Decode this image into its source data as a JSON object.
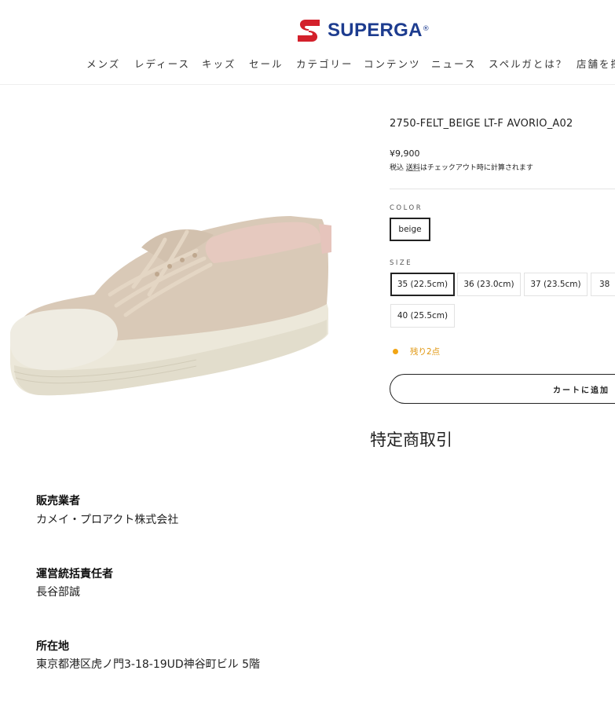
{
  "header": {
    "brand": "SUPERGA",
    "brand_mark": "®",
    "nav": [
      "メンズ",
      "レディース",
      "キッズ",
      "セール",
      "カテゴリー",
      "コンテンツ",
      "ニュース",
      "スペルガとは？",
      "店舗を探"
    ]
  },
  "product": {
    "title": "2750-FELT_BEIGE LT-F AVORIO_A02",
    "price": "¥9,900",
    "tax_prefix": "税込 ",
    "tax_link": "送料",
    "tax_suffix": "はチェックアウト時に計算されます",
    "color_label": "COLOR",
    "color_options": [
      "beige"
    ],
    "size_label": "SIZE",
    "size_options": [
      "35 (22.5cm)",
      "36 (23.0cm)",
      "37 (23.5cm)",
      "38",
      "40 (25.5cm)"
    ],
    "stock_text": "残り2点",
    "add_to_cart": "カートに追加"
  },
  "legal": {
    "heading": "特定商取引",
    "items": [
      {
        "label": "販売業者",
        "value": "カメイ・プロアクト株式会社"
      },
      {
        "label": "運営統括責任者",
        "value": "長谷部誠"
      },
      {
        "label": "所在地",
        "value": "東京都港区虎ノ門3-18-19UD神谷町ビル 5階"
      }
    ]
  },
  "colors": {
    "brand_red": "#d3202b",
    "brand_blue": "#1d3c8f",
    "stock_orange": "#f2a514"
  }
}
